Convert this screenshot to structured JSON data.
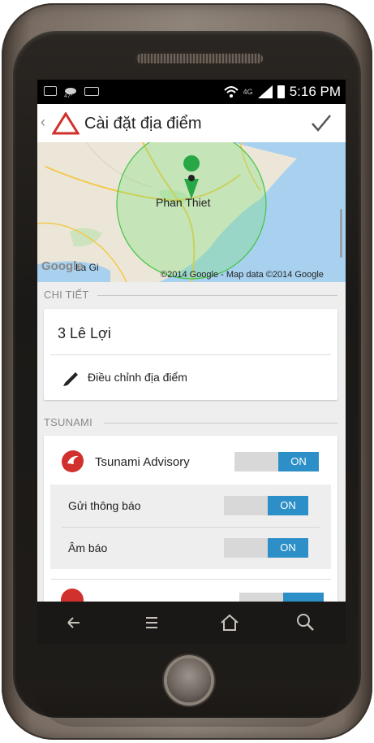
{
  "status_bar": {
    "time": "5:16 PM",
    "network": "4G"
  },
  "action_bar": {
    "title": "Cài đặt địa điểm",
    "back_icon": "chevron-left-icon",
    "confirm_icon": "check-icon"
  },
  "map": {
    "city_label": "Phan Thiet",
    "town_label": "La Gi",
    "attribution": "©2014 Google - Map data ©2014 Google",
    "logo": "Google"
  },
  "details_section": {
    "header": "CHI TIẾT",
    "address": "3 Lê Lợi",
    "edit_label": "Điều chỉnh địa điểm"
  },
  "tsunami_section": {
    "header": "TSUNAMI",
    "alert_name": "Tsunami Advisory",
    "alert_toggle": "ON",
    "notify_label": "Gửi thông báo",
    "notify_toggle": "ON",
    "sound_label": "Âm báo",
    "sound_toggle": "ON"
  },
  "colors": {
    "accent": "#2d8fc7",
    "alert_red": "#d0312d",
    "geofence": "#7fe07f"
  }
}
